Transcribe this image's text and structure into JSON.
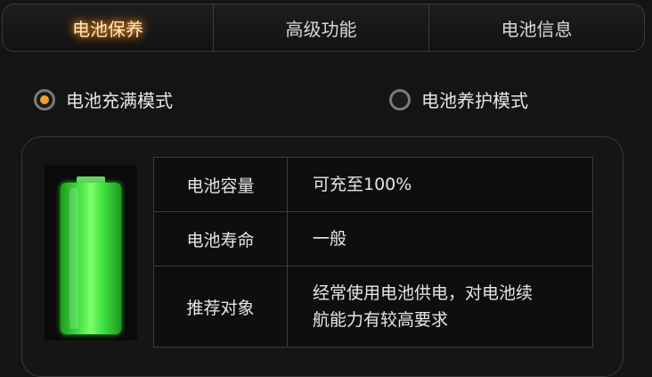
{
  "tabs": [
    {
      "label": "电池保养",
      "active": true
    },
    {
      "label": "高级功能",
      "active": false
    },
    {
      "label": "电池信息",
      "active": false
    }
  ],
  "modes": [
    {
      "label": "电池充满模式",
      "selected": true
    },
    {
      "label": "电池养护模式",
      "selected": false
    }
  ],
  "battery": {
    "level_percent": 100,
    "color": "#41e041"
  },
  "info_table": [
    {
      "key": "电池容量",
      "value": "可充至100%"
    },
    {
      "key": "电池寿命",
      "value": "一般"
    },
    {
      "key": "推荐对象",
      "value_line1": "经常使用电池供电，对电池续",
      "value_line2": "航能力有较高要求"
    }
  ],
  "colors": {
    "accent": "#f0a030",
    "background": "#141414"
  }
}
